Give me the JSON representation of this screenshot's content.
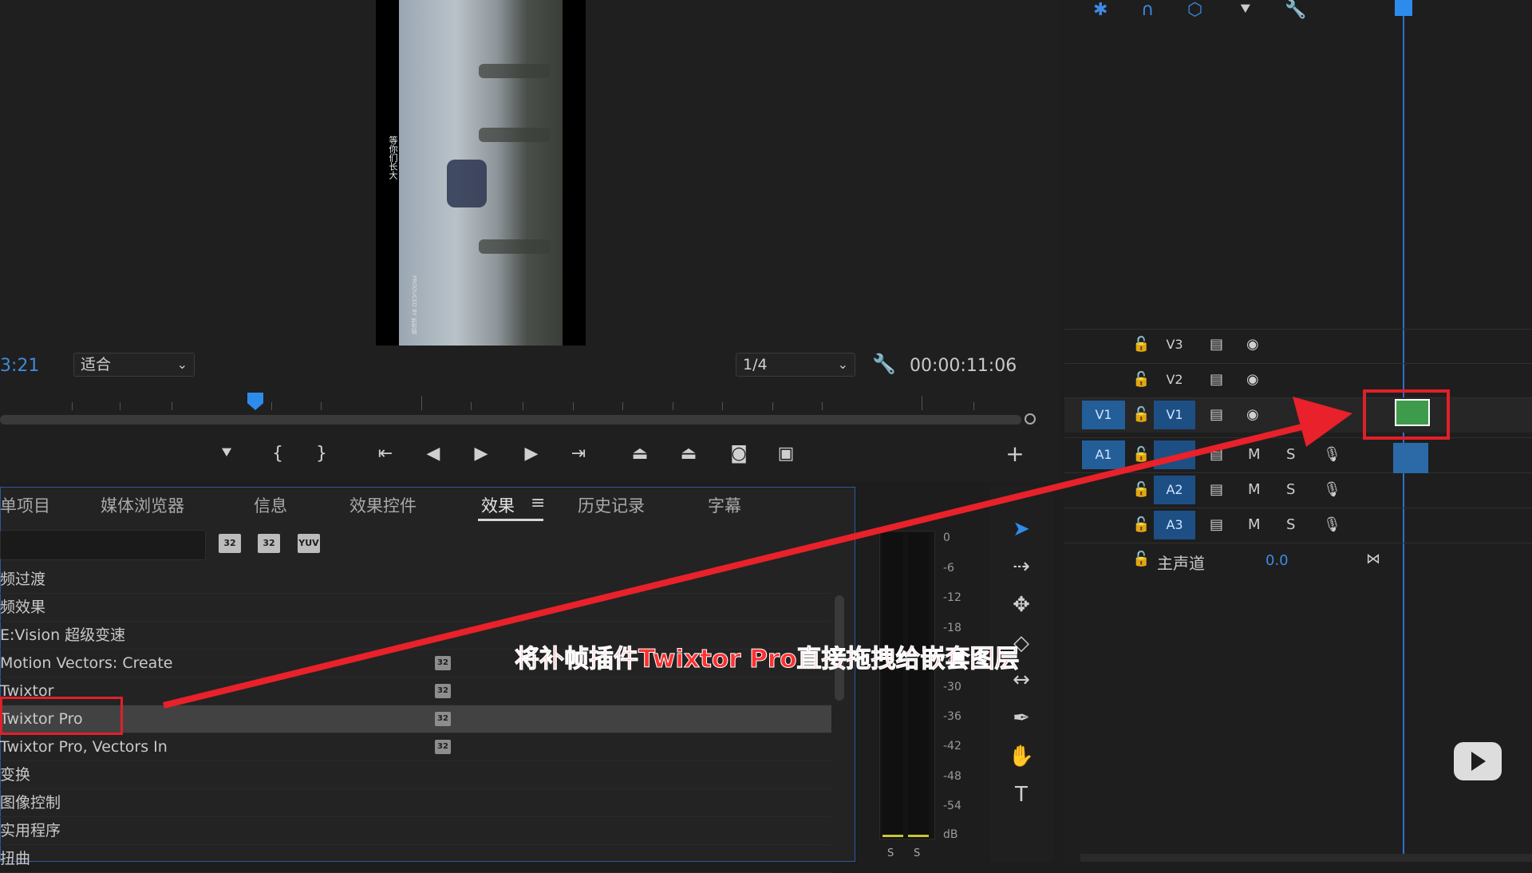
{
  "monitor": {
    "timecode_left": "3:21",
    "fit_label": "适合",
    "resolution": "1/4",
    "timecode_right": "00:00:11:06",
    "video_text_vertical": "等你们长大",
    "video_text_small": "PRODUCED BY 新剪辑"
  },
  "panel": {
    "tabs": [
      "单项目",
      "媒体浏览器",
      "信息",
      "效果控件",
      "效果",
      "历史记录",
      "字幕"
    ],
    "active_tab": "效果",
    "filter_buttons": [
      "32",
      "32",
      "YUV"
    ],
    "rows": [
      {
        "label": "频过渡",
        "badge": ""
      },
      {
        "label": "频效果",
        "badge": ""
      },
      {
        "label": "E:Vision 超级变速",
        "badge": ""
      },
      {
        "label": "Motion Vectors: Create",
        "badge": "32"
      },
      {
        "label": "Twixtor",
        "badge": "32"
      },
      {
        "label": "Twixtor Pro",
        "badge": "32"
      },
      {
        "label": "Twixtor Pro, Vectors In",
        "badge": "32"
      },
      {
        "label": "变换",
        "badge": ""
      },
      {
        "label": "图像控制",
        "badge": ""
      },
      {
        "label": "实用程序",
        "badge": ""
      },
      {
        "label": "扭曲",
        "badge": ""
      }
    ],
    "selected_row": "Twixtor Pro"
  },
  "meter": {
    "scale": [
      "0",
      "-6",
      "-12",
      "-18",
      "-24",
      "-30",
      "-36",
      "-42",
      "-48",
      "-54",
      "dB"
    ],
    "solo_labels": [
      "S",
      "S"
    ]
  },
  "timeline": {
    "tracks": [
      {
        "src": "",
        "name": "V3"
      },
      {
        "src": "",
        "name": "V2"
      },
      {
        "src": "V1",
        "name": "V1"
      },
      {
        "src": "A1",
        "name": "A1"
      },
      {
        "src": "",
        "name": "A2"
      },
      {
        "src": "",
        "name": "A3"
      }
    ],
    "mute_label": "M",
    "solo_label": "S",
    "master_label": "主声道",
    "master_value": "0.0"
  },
  "annotation": "将补帧插件Twixtor Pro直接拖拽给嵌套图层",
  "colors": {
    "accent": "#2d8ceb",
    "annotation_red": "#e02028"
  }
}
